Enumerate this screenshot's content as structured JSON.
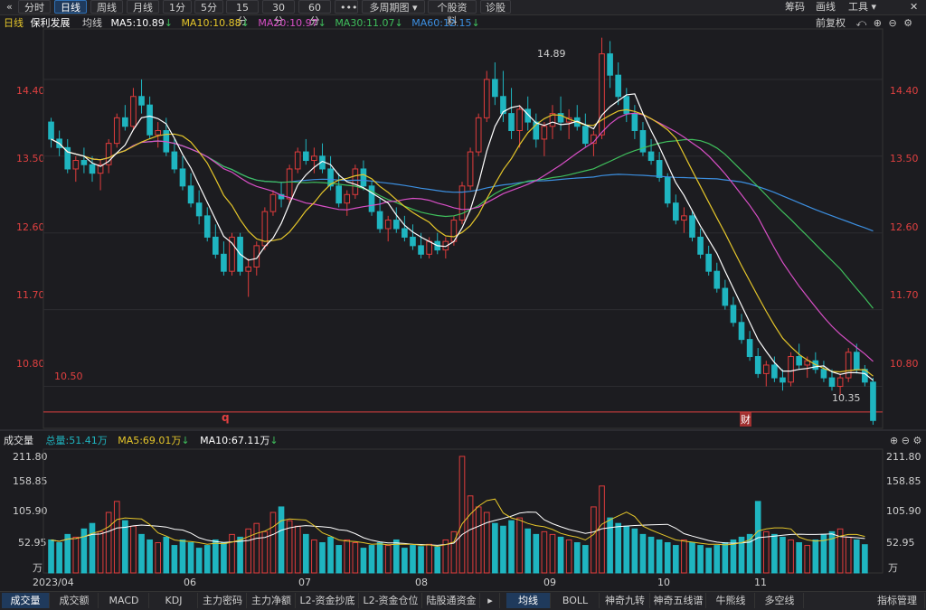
{
  "toolbar": {
    "back_icon": "«",
    "items": [
      "分时",
      "日线",
      "周线",
      "月线",
      "1分",
      "5分",
      "15分",
      "30分",
      "60分",
      "•••",
      "多周期图 ▾",
      "个股资料",
      "诊股"
    ],
    "active_index": 1,
    "right": [
      "筹码",
      "画线",
      "工具 ▾"
    ]
  },
  "main_legend": {
    "period": "日线",
    "stock_name": "保利发展",
    "indicator": "均线",
    "ma5": "MA5:10.89",
    "ma10": "MA10:10.88",
    "ma20": "MA20:10.97",
    "ma30": "MA30:11.07",
    "ma60": "MA60:12.15",
    "adjust": "前复权"
  },
  "price_axis": {
    "ticks": [
      "14.40",
      "13.50",
      "12.60",
      "11.70",
      "10.80"
    ],
    "high_label": "14.89",
    "low_label": "10.35",
    "line_label": "10.50"
  },
  "markers": {
    "q": "q",
    "cai": "财"
  },
  "volume_legend": {
    "label": "成交量",
    "total": "总量:51.41万",
    "ma5": "MA5:69.01万",
    "ma10": "MA10:67.11万"
  },
  "volume_axis": {
    "ticks": [
      "211.80",
      "158.85",
      "105.90",
      "52.95"
    ],
    "unit": "万"
  },
  "x_axis": [
    "2023/04",
    "06",
    "07",
    "08",
    "09",
    "10",
    "11"
  ],
  "bottom_tabs": [
    "成交量",
    "成交额",
    "MACD",
    "KDJ",
    "主力密码",
    "主力净额",
    "L2-资金抄底",
    "L2-资金仓位",
    "陆股通资金"
  ],
  "bottom_tabs_right": [
    "均线",
    "BOLL",
    "神奇九转",
    "神奇五线谱",
    "牛熊线",
    "多空线",
    "指标管理"
  ],
  "colors": {
    "up": "#e03c3c",
    "down": "#1fb5c0",
    "ma5": "#ffffff",
    "ma10": "#e5c62a",
    "ma20": "#d84fc6",
    "ma30": "#3fbf5c",
    "ma60": "#3c8fe0"
  },
  "chart_data": {
    "type": "candlestick",
    "ylim": [
      10.35,
      14.95
    ],
    "candles_ohlc": [
      [
        13.9,
        13.95,
        13.6,
        13.7
      ],
      [
        13.7,
        13.8,
        13.5,
        13.6
      ],
      [
        13.6,
        13.7,
        13.3,
        13.35
      ],
      [
        13.35,
        13.5,
        13.2,
        13.45
      ],
      [
        13.45,
        13.6,
        13.3,
        13.4
      ],
      [
        13.4,
        13.5,
        13.2,
        13.3
      ],
      [
        13.3,
        13.45,
        13.1,
        13.4
      ],
      [
        13.4,
        13.7,
        13.3,
        13.65
      ],
      [
        13.65,
        14.0,
        13.6,
        13.95
      ],
      [
        13.95,
        14.1,
        13.8,
        13.85
      ],
      [
        13.85,
        14.3,
        13.8,
        14.2
      ],
      [
        14.2,
        14.4,
        14.0,
        14.1
      ],
      [
        14.1,
        14.2,
        13.7,
        13.75
      ],
      [
        13.75,
        13.9,
        13.6,
        13.8
      ],
      [
        13.8,
        13.95,
        13.5,
        13.55
      ],
      [
        13.55,
        13.7,
        13.3,
        13.35
      ],
      [
        13.35,
        13.5,
        13.1,
        13.15
      ],
      [
        13.15,
        13.3,
        12.9,
        12.95
      ],
      [
        12.95,
        13.1,
        12.7,
        12.8
      ],
      [
        12.8,
        12.9,
        12.5,
        12.55
      ],
      [
        12.55,
        12.7,
        12.3,
        12.35
      ],
      [
        12.35,
        12.5,
        12.1,
        12.15
      ],
      [
        12.15,
        12.6,
        12.1,
        12.55
      ],
      [
        12.55,
        12.6,
        12.1,
        12.15
      ],
      [
        12.15,
        12.3,
        11.85,
        12.2
      ],
      [
        12.2,
        12.5,
        12.1,
        12.45
      ],
      [
        12.45,
        12.9,
        12.4,
        12.85
      ],
      [
        12.85,
        13.1,
        12.8,
        13.05
      ],
      [
        13.05,
        13.2,
        12.9,
        13.0
      ],
      [
        13.0,
        13.4,
        12.95,
        13.35
      ],
      [
        13.35,
        13.6,
        13.3,
        13.55
      ],
      [
        13.55,
        13.7,
        13.4,
        13.45
      ],
      [
        13.45,
        13.6,
        13.3,
        13.5
      ],
      [
        13.5,
        13.65,
        13.3,
        13.35
      ],
      [
        13.35,
        13.5,
        13.1,
        13.15
      ],
      [
        13.15,
        13.3,
        12.9,
        12.95
      ],
      [
        12.95,
        13.1,
        12.8,
        13.05
      ],
      [
        13.05,
        13.4,
        13.0,
        13.35
      ],
      [
        13.35,
        13.45,
        13.1,
        13.15
      ],
      [
        13.15,
        13.2,
        12.8,
        12.85
      ],
      [
        12.85,
        13.0,
        12.6,
        12.65
      ],
      [
        12.65,
        12.8,
        12.5,
        12.75
      ],
      [
        12.75,
        12.9,
        12.6,
        12.65
      ],
      [
        12.65,
        12.8,
        12.5,
        12.55
      ],
      [
        12.55,
        12.7,
        12.4,
        12.45
      ],
      [
        12.45,
        12.6,
        12.3,
        12.35
      ],
      [
        12.35,
        12.55,
        12.3,
        12.5
      ],
      [
        12.5,
        12.6,
        12.35,
        12.4
      ],
      [
        12.4,
        12.55,
        12.3,
        12.5
      ],
      [
        12.5,
        12.8,
        12.45,
        12.75
      ],
      [
        12.75,
        13.2,
        12.7,
        13.15
      ],
      [
        13.15,
        13.6,
        13.1,
        13.55
      ],
      [
        13.55,
        14.0,
        13.5,
        13.95
      ],
      [
        13.95,
        14.5,
        13.9,
        14.4
      ],
      [
        14.4,
        14.6,
        14.1,
        14.2
      ],
      [
        14.2,
        14.5,
        13.9,
        14.0
      ],
      [
        14.0,
        14.3,
        13.7,
        13.8
      ],
      [
        13.8,
        14.1,
        13.6,
        14.05
      ],
      [
        14.05,
        14.2,
        13.8,
        13.9
      ],
      [
        13.9,
        14.0,
        13.6,
        13.7
      ],
      [
        13.7,
        13.9,
        13.5,
        13.85
      ],
      [
        13.85,
        14.1,
        13.7,
        14.0
      ],
      [
        14.0,
        14.2,
        13.8,
        13.9
      ],
      [
        13.9,
        14.05,
        13.7,
        13.95
      ],
      [
        13.95,
        14.1,
        13.8,
        13.85
      ],
      [
        13.85,
        14.0,
        13.6,
        13.65
      ],
      [
        13.65,
        13.8,
        13.5,
        13.75
      ],
      [
        13.75,
        14.89,
        13.7,
        14.7
      ],
      [
        14.7,
        14.85,
        14.3,
        14.45
      ],
      [
        14.45,
        14.6,
        14.1,
        14.2
      ],
      [
        14.2,
        14.3,
        13.9,
        14.0
      ],
      [
        14.0,
        14.1,
        13.7,
        13.8
      ],
      [
        13.8,
        13.9,
        13.5,
        13.55
      ],
      [
        13.55,
        13.7,
        13.4,
        13.45
      ],
      [
        13.45,
        13.55,
        13.2,
        13.25
      ],
      [
        13.25,
        13.3,
        12.9,
        12.95
      ],
      [
        12.95,
        13.05,
        12.7,
        12.75
      ],
      [
        12.75,
        12.9,
        12.6,
        12.8
      ],
      [
        12.8,
        12.85,
        12.5,
        12.55
      ],
      [
        12.55,
        12.65,
        12.3,
        12.35
      ],
      [
        12.35,
        12.45,
        12.1,
        12.15
      ],
      [
        12.15,
        12.25,
        11.9,
        11.95
      ],
      [
        11.95,
        12.05,
        11.7,
        11.75
      ],
      [
        11.75,
        11.85,
        11.5,
        11.55
      ],
      [
        11.55,
        11.65,
        11.3,
        11.35
      ],
      [
        11.35,
        11.45,
        11.1,
        11.15
      ],
      [
        11.15,
        11.25,
        10.9,
        10.95
      ],
      [
        10.95,
        11.1,
        10.8,
        11.05
      ],
      [
        11.05,
        11.15,
        10.85,
        10.9
      ],
      [
        10.9,
        11.0,
        10.75,
        10.85
      ],
      [
        10.85,
        11.2,
        10.8,
        11.15
      ],
      [
        11.15,
        11.3,
        11.0,
        11.05
      ],
      [
        11.05,
        11.15,
        10.9,
        11.1
      ],
      [
        11.1,
        11.2,
        10.95,
        11.0
      ],
      [
        11.0,
        11.1,
        10.85,
        10.9
      ],
      [
        10.9,
        11.0,
        10.75,
        10.8
      ],
      [
        10.8,
        10.95,
        10.7,
        10.9
      ],
      [
        10.9,
        11.25,
        10.85,
        11.2
      ],
      [
        11.2,
        11.3,
        10.95,
        11.0
      ],
      [
        11.0,
        11.05,
        10.8,
        10.85
      ],
      [
        10.85,
        10.9,
        10.35,
        10.4
      ]
    ],
    "volume": [
      60,
      55,
      70,
      65,
      80,
      90,
      75,
      110,
      130,
      95,
      85,
      70,
      60,
      55,
      65,
      50,
      60,
      55,
      45,
      50,
      60,
      55,
      70,
      65,
      80,
      90,
      75,
      110,
      120,
      95,
      85,
      70,
      60,
      55,
      65,
      50,
      60,
      55,
      45,
      50,
      55,
      50,
      60,
      45,
      50,
      48,
      52,
      47,
      60,
      75,
      211.8,
      140,
      120,
      110,
      90,
      85,
      95,
      100,
      80,
      70,
      75,
      70,
      65,
      60,
      55,
      50,
      120,
      158,
      100,
      90,
      85,
      80,
      70,
      65,
      60,
      55,
      50,
      60,
      55,
      50,
      45,
      50,
      55,
      60,
      65,
      70,
      130,
      75,
      70,
      65,
      60,
      55,
      50,
      60,
      70,
      75,
      80,
      65,
      60,
      51.41
    ],
    "ma_series": [
      "MA5",
      "MA10",
      "MA20",
      "MA30",
      "MA60"
    ],
    "x_tick_labels": [
      "2023/04",
      "06",
      "07",
      "08",
      "09",
      "10",
      "11"
    ]
  }
}
